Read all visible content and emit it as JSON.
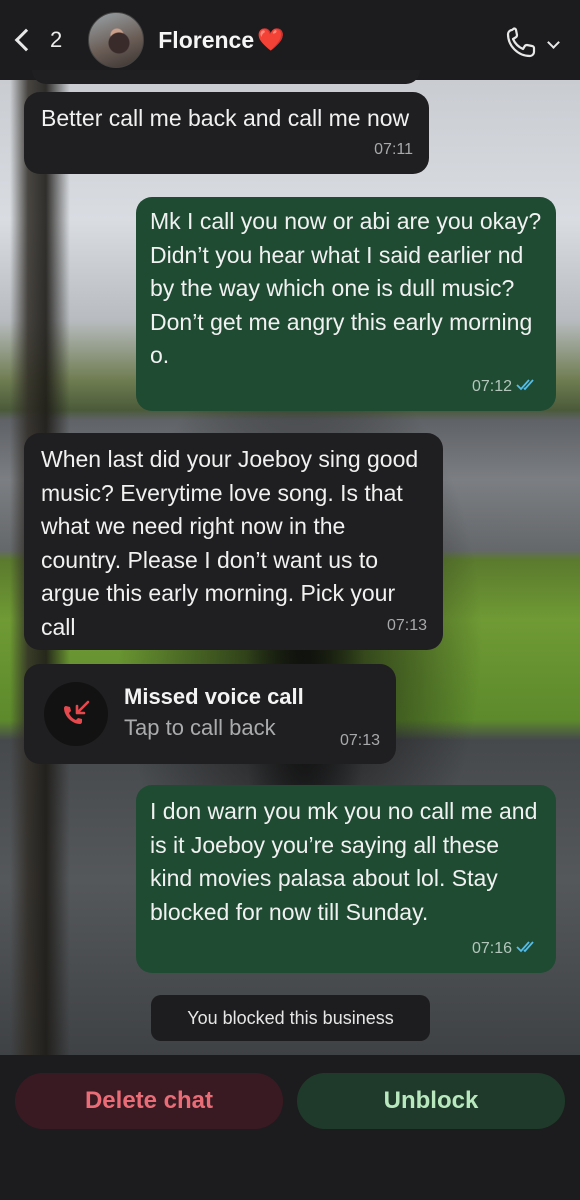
{
  "header": {
    "back_count": "2",
    "contact_name": "Florence",
    "heart": "❤️",
    "icons": {
      "back": "chevron-left-icon",
      "call": "phone-icon",
      "dropdown": "chevron-down-icon"
    }
  },
  "messages": [
    {
      "direction": "incoming",
      "text": "Better call me back and call me now",
      "time": "07:11"
    },
    {
      "direction": "outgoing",
      "text": "Mk I call you now or abi are you okay? Didn’t you hear what I said earlier nd by the way which one is dull music? Don’t get me angry this early morning o.",
      "time": "07:12",
      "status": "read"
    },
    {
      "direction": "incoming",
      "text": "When last did your Joeboy sing good music? Everytime love song. Is that what we need right now in the country. Please I don’t want us to argue this early morning. Pick your call",
      "time": "07:13"
    },
    {
      "direction": "outgoing",
      "text": "I don warn you mk you no call me and is it Joeboy you’re saying all these kind movies palasa about lol. Stay blocked for now till Sunday.",
      "time": "07:16",
      "status": "read"
    }
  ],
  "missed_call": {
    "title": "Missed voice call",
    "subtitle": "Tap to call back",
    "time": "07:13",
    "icon": "missed-call-icon"
  },
  "system_notice": "You blocked this business",
  "actions": {
    "delete_label": "Delete chat",
    "unblock_label": "Unblock"
  },
  "colors": {
    "incoming_bubble": "#1f1f21",
    "outgoing_bubble": "#1f4b33",
    "delete_text": "#ea6c76",
    "unblock_text": "#b9e8be",
    "read_ticks": "#53bdeb",
    "missed_call_red": "#e5484d"
  }
}
